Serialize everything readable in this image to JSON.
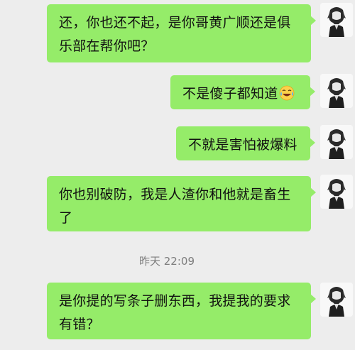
{
  "messages": [
    {
      "text": "还，你也还不起，是你哥黄广顺还是俱乐部在帮你吧？",
      "line1": "还，你也还不起，是你哥黄广顺还是俱",
      "line2": "乐部在帮你吧？"
    },
    {
      "text": "不是傻子都知道",
      "emoji": "laughing-tears-emoji"
    },
    {
      "text": "不就是害怕被爆料"
    },
    {
      "text": "你也别破防，我是人渣你和他就是畜生了",
      "line1": "你也别破防，我是人渣你和他就是畜生",
      "line2": "了"
    },
    {
      "text": "是你提的写条子删东西，我提我的要求有错？",
      "line1": "是你提的写条子删东西，我提我的要求",
      "line2": "有错？"
    }
  ],
  "timestamp": "昨天 22:09",
  "colors": {
    "background": "#ededed",
    "outgoing_bubble": "#95ec69",
    "timestamp_text": "#7d7d7d"
  }
}
